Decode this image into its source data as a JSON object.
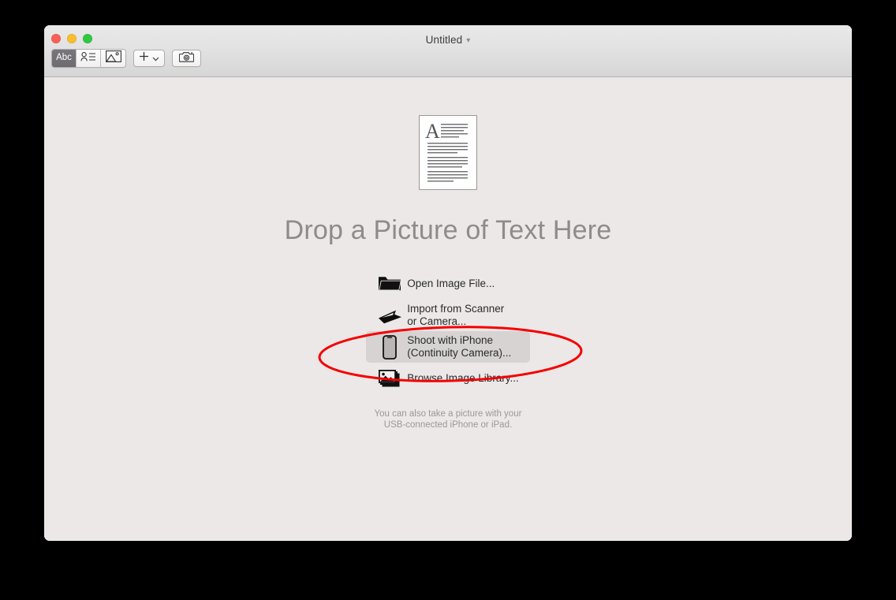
{
  "window": {
    "title": "Untitled",
    "title_chevron_icon": "chevron-down-icon",
    "traffic_lights": [
      {
        "name": "close",
        "color": "#fa5e57"
      },
      {
        "name": "minimize",
        "color": "#f9bd2e"
      },
      {
        "name": "zoom",
        "color": "#2fc840"
      }
    ]
  },
  "toolbar": {
    "segmented": [
      {
        "id": "text-mode",
        "label": "Abc",
        "icon": "abc-text-icon",
        "selected": true
      },
      {
        "id": "contact-mode",
        "label": "",
        "icon": "person-list-icon",
        "selected": false
      },
      {
        "id": "image-mode",
        "label": "",
        "icon": "photo-icon",
        "selected": false
      }
    ],
    "add_button": {
      "label": "",
      "icon": "plus-icon",
      "menu_icon": "chevron-down-icon"
    },
    "camera_button": {
      "label": "",
      "icon": "camera-icon"
    }
  },
  "main": {
    "preview": {
      "icon": "document-with-text-preview",
      "dropcap": "A"
    },
    "headline": "Drop a Picture of Text Here",
    "actions": [
      {
        "id": "open-image-file",
        "label": "Open Image File...",
        "icon": "folder-icon",
        "highlighted": false
      },
      {
        "id": "import-from-scanner",
        "label": "Import from Scanner\nor Camera...",
        "icon": "scanner-icon",
        "highlighted": false
      },
      {
        "id": "shoot-with-iphone",
        "label": "Shoot with iPhone\n(Continuity Camera)...",
        "icon": "iphone-icon",
        "highlighted": true
      },
      {
        "id": "browse-image-library",
        "label": "Browse Image Library...",
        "icon": "photo-stack-icon",
        "highlighted": false
      }
    ],
    "footnote": "You can also take a picture with your\nUSB-connected iPhone or iPad."
  },
  "annotation": {
    "shape": "ellipse",
    "color": "#f50000",
    "stroke_width": 3,
    "targets": "shoot-with-iphone"
  },
  "colors": {
    "window_background": "#ebe8e7",
    "titlebar_top": "#e9e9e9",
    "titlebar_bottom": "#d6d6d6",
    "highlight_row": "#d6d3d2",
    "headline_text": "#8e8b8a",
    "body_text": "#2b2b2b",
    "muted_text": "#9b9897",
    "desktop_background": "#000000"
  }
}
